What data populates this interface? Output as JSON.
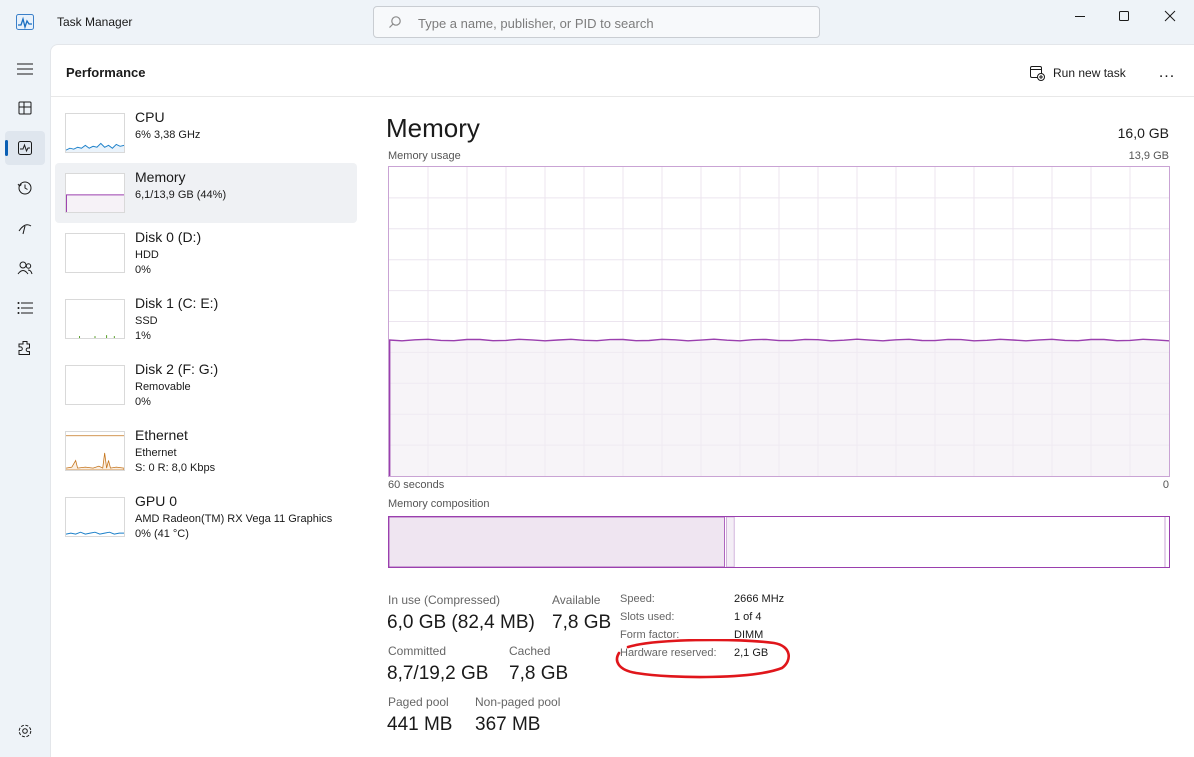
{
  "app": {
    "title": "Task Manager"
  },
  "search": {
    "placeholder": "Type a name, publisher, or PID to search"
  },
  "window_controls": [
    "minimize-icon",
    "maximize-icon",
    "close-icon"
  ],
  "nav_rail": {
    "items": [
      {
        "name": "hamburger-icon"
      },
      {
        "name": "processes-icon"
      },
      {
        "name": "performance-icon",
        "active": true
      },
      {
        "name": "app-history-icon"
      },
      {
        "name": "startup-apps-icon"
      },
      {
        "name": "users-icon"
      },
      {
        "name": "details-icon"
      },
      {
        "name": "services-icon"
      }
    ],
    "settings": "settings-icon"
  },
  "header": {
    "title": "Performance",
    "run_task_label": "Run new task",
    "more_label": "..."
  },
  "resources": [
    {
      "name": "CPU",
      "sub1": "6% 3,38 GHz",
      "sub2": ""
    },
    {
      "name": "Memory",
      "sub1": "6,1/13,9 GB (44%)",
      "sub2": "",
      "selected": true
    },
    {
      "name": "Disk 0 (D:)",
      "sub1": "HDD",
      "sub2": "0%"
    },
    {
      "name": "Disk 1 (C: E:)",
      "sub1": "SSD",
      "sub2": "1%"
    },
    {
      "name": "Disk 2 (F: G:)",
      "sub1": "Removable",
      "sub2": "0%"
    },
    {
      "name": "Ethernet",
      "sub1": "Ethernet",
      "sub2": "S: 0 R: 8,0 Kbps"
    },
    {
      "name": "GPU 0",
      "sub1": "AMD Radeon(TM) RX Vega 11 Graphics",
      "sub2": "0% (41 °C)"
    }
  ],
  "detail": {
    "title": "Memory",
    "total": "16,0 GB",
    "usage_label": "Memory usage",
    "usage_max": "13,9 GB",
    "x_left": "60 seconds",
    "x_right": "0",
    "usage_level": 0.44,
    "composition_label": "Memory composition",
    "composition": {
      "in_use_fraction": 0.43,
      "modified_fraction": 0.01,
      "free_fraction": 0.56
    },
    "stats": {
      "in_use_label": "In use (Compressed)",
      "in_use_value": "6,0 GB (82,4 MB)",
      "available_label": "Available",
      "available_value": "7,8 GB",
      "committed_label": "Committed",
      "committed_value": "8,7/19,2 GB",
      "cached_label": "Cached",
      "cached_value": "7,8 GB",
      "paged_label": "Paged pool",
      "paged_value": "441 MB",
      "nonpaged_label": "Non-paged pool",
      "nonpaged_value": "367 MB"
    },
    "specs": {
      "speed_label": "Speed:",
      "speed_value": "2666 MHz",
      "slots_label": "Slots used:",
      "slots_value": "1 of 4",
      "form_label": "Form factor:",
      "form_value": "DIMM",
      "hw_label": "Hardware reserved:",
      "hw_value": "2,1 GB"
    }
  },
  "colors": {
    "memory_accent": "#9a3fae",
    "memory_fill": "#f1ecf3",
    "cpu_accent": "#1a7fc9",
    "ethernet_accent": "#c4731a",
    "annotation": "#e0161b"
  }
}
